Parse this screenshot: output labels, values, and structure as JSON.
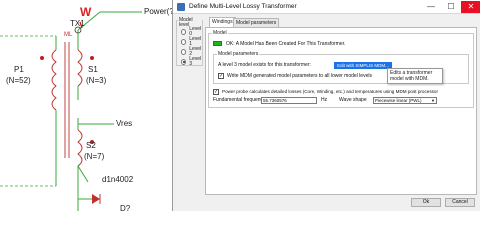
{
  "schematic": {
    "tx_label": "TX1",
    "ml_label": "ML",
    "w_label": "W",
    "power_label": "Power(?",
    "p1_label": "P1",
    "p1_turns": "(N=52)",
    "s1_label": "S1",
    "s1_turns": "(N=3)",
    "vres_label": "Vres",
    "s2_label": "S2",
    "s2_turns": "(N=7)",
    "diode_label": "d1n4002",
    "d_label": "D?"
  },
  "window": {
    "title": "Define Multi-Level Lossy Transformer",
    "minimize": "—",
    "maximize": "☐",
    "close": "✕"
  },
  "model_level": {
    "title": "Model level",
    "options": [
      "Level 0",
      "Level 1",
      "Level 2",
      "Level 3"
    ],
    "selected": "Level 3"
  },
  "tabs": [
    "Windings",
    "Model parameters"
  ],
  "active_tab": "Windings",
  "model_group": {
    "title": "Model",
    "status_text": "OK: A Model Has Been Created For This Transformer.",
    "status_color": "#1db41d"
  },
  "model_params": {
    "title": "Model parameters",
    "level_exists_text": "A level 3 model exists for this transformer:",
    "edit_button": "Edit with SIMPLIS MDM...",
    "write_checkbox_label": "Write MDM generated model parameters to all lower model levels",
    "write_checked": true,
    "tooltip_line1": "Edits a transformer",
    "tooltip_line2": "model with MDM."
  },
  "power_probe": {
    "checkbox_label": "Power probe calculates detailed losses (Core, Winding, etc.) and temperatures using MDM post processor",
    "checked": true,
    "freq_label": "Fundamental frequency",
    "freq_value": "55.7360576",
    "freq_unit": "Hz",
    "wave_label": "Wave shape",
    "wave_value": "Piecewise linear (PWL)"
  },
  "buttons": {
    "ok": "Ok",
    "cancel": "Cancel"
  }
}
